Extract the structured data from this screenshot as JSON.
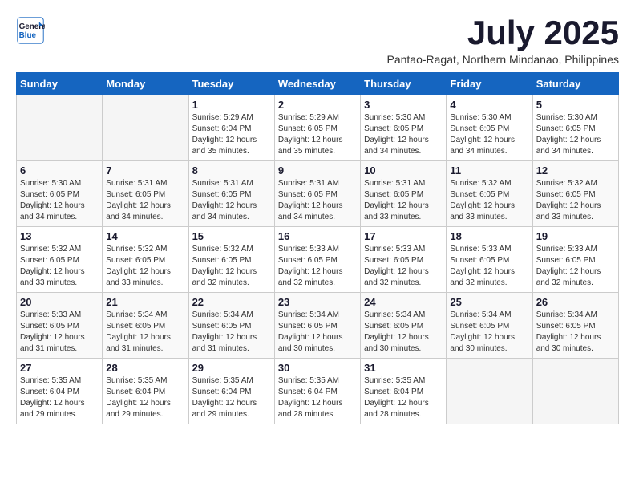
{
  "logo": {
    "line1": "General",
    "line2": "Blue"
  },
  "title": "July 2025",
  "location": "Pantao-Ragat, Northern Mindanao, Philippines",
  "days_header": [
    "Sunday",
    "Monday",
    "Tuesday",
    "Wednesday",
    "Thursday",
    "Friday",
    "Saturday"
  ],
  "weeks": [
    [
      {
        "num": "",
        "sunrise": "",
        "sunset": "",
        "daylight": ""
      },
      {
        "num": "",
        "sunrise": "",
        "sunset": "",
        "daylight": ""
      },
      {
        "num": "1",
        "sunrise": "Sunrise: 5:29 AM",
        "sunset": "Sunset: 6:04 PM",
        "daylight": "Daylight: 12 hours and 35 minutes."
      },
      {
        "num": "2",
        "sunrise": "Sunrise: 5:29 AM",
        "sunset": "Sunset: 6:05 PM",
        "daylight": "Daylight: 12 hours and 35 minutes."
      },
      {
        "num": "3",
        "sunrise": "Sunrise: 5:30 AM",
        "sunset": "Sunset: 6:05 PM",
        "daylight": "Daylight: 12 hours and 34 minutes."
      },
      {
        "num": "4",
        "sunrise": "Sunrise: 5:30 AM",
        "sunset": "Sunset: 6:05 PM",
        "daylight": "Daylight: 12 hours and 34 minutes."
      },
      {
        "num": "5",
        "sunrise": "Sunrise: 5:30 AM",
        "sunset": "Sunset: 6:05 PM",
        "daylight": "Daylight: 12 hours and 34 minutes."
      }
    ],
    [
      {
        "num": "6",
        "sunrise": "Sunrise: 5:30 AM",
        "sunset": "Sunset: 6:05 PM",
        "daylight": "Daylight: 12 hours and 34 minutes."
      },
      {
        "num": "7",
        "sunrise": "Sunrise: 5:31 AM",
        "sunset": "Sunset: 6:05 PM",
        "daylight": "Daylight: 12 hours and 34 minutes."
      },
      {
        "num": "8",
        "sunrise": "Sunrise: 5:31 AM",
        "sunset": "Sunset: 6:05 PM",
        "daylight": "Daylight: 12 hours and 34 minutes."
      },
      {
        "num": "9",
        "sunrise": "Sunrise: 5:31 AM",
        "sunset": "Sunset: 6:05 PM",
        "daylight": "Daylight: 12 hours and 34 minutes."
      },
      {
        "num": "10",
        "sunrise": "Sunrise: 5:31 AM",
        "sunset": "Sunset: 6:05 PM",
        "daylight": "Daylight: 12 hours and 33 minutes."
      },
      {
        "num": "11",
        "sunrise": "Sunrise: 5:32 AM",
        "sunset": "Sunset: 6:05 PM",
        "daylight": "Daylight: 12 hours and 33 minutes."
      },
      {
        "num": "12",
        "sunrise": "Sunrise: 5:32 AM",
        "sunset": "Sunset: 6:05 PM",
        "daylight": "Daylight: 12 hours and 33 minutes."
      }
    ],
    [
      {
        "num": "13",
        "sunrise": "Sunrise: 5:32 AM",
        "sunset": "Sunset: 6:05 PM",
        "daylight": "Daylight: 12 hours and 33 minutes."
      },
      {
        "num": "14",
        "sunrise": "Sunrise: 5:32 AM",
        "sunset": "Sunset: 6:05 PM",
        "daylight": "Daylight: 12 hours and 33 minutes."
      },
      {
        "num": "15",
        "sunrise": "Sunrise: 5:32 AM",
        "sunset": "Sunset: 6:05 PM",
        "daylight": "Daylight: 12 hours and 32 minutes."
      },
      {
        "num": "16",
        "sunrise": "Sunrise: 5:33 AM",
        "sunset": "Sunset: 6:05 PM",
        "daylight": "Daylight: 12 hours and 32 minutes."
      },
      {
        "num": "17",
        "sunrise": "Sunrise: 5:33 AM",
        "sunset": "Sunset: 6:05 PM",
        "daylight": "Daylight: 12 hours and 32 minutes."
      },
      {
        "num": "18",
        "sunrise": "Sunrise: 5:33 AM",
        "sunset": "Sunset: 6:05 PM",
        "daylight": "Daylight: 12 hours and 32 minutes."
      },
      {
        "num": "19",
        "sunrise": "Sunrise: 5:33 AM",
        "sunset": "Sunset: 6:05 PM",
        "daylight": "Daylight: 12 hours and 32 minutes."
      }
    ],
    [
      {
        "num": "20",
        "sunrise": "Sunrise: 5:33 AM",
        "sunset": "Sunset: 6:05 PM",
        "daylight": "Daylight: 12 hours and 31 minutes."
      },
      {
        "num": "21",
        "sunrise": "Sunrise: 5:34 AM",
        "sunset": "Sunset: 6:05 PM",
        "daylight": "Daylight: 12 hours and 31 minutes."
      },
      {
        "num": "22",
        "sunrise": "Sunrise: 5:34 AM",
        "sunset": "Sunset: 6:05 PM",
        "daylight": "Daylight: 12 hours and 31 minutes."
      },
      {
        "num": "23",
        "sunrise": "Sunrise: 5:34 AM",
        "sunset": "Sunset: 6:05 PM",
        "daylight": "Daylight: 12 hours and 30 minutes."
      },
      {
        "num": "24",
        "sunrise": "Sunrise: 5:34 AM",
        "sunset": "Sunset: 6:05 PM",
        "daylight": "Daylight: 12 hours and 30 minutes."
      },
      {
        "num": "25",
        "sunrise": "Sunrise: 5:34 AM",
        "sunset": "Sunset: 6:05 PM",
        "daylight": "Daylight: 12 hours and 30 minutes."
      },
      {
        "num": "26",
        "sunrise": "Sunrise: 5:34 AM",
        "sunset": "Sunset: 6:05 PM",
        "daylight": "Daylight: 12 hours and 30 minutes."
      }
    ],
    [
      {
        "num": "27",
        "sunrise": "Sunrise: 5:35 AM",
        "sunset": "Sunset: 6:04 PM",
        "daylight": "Daylight: 12 hours and 29 minutes."
      },
      {
        "num": "28",
        "sunrise": "Sunrise: 5:35 AM",
        "sunset": "Sunset: 6:04 PM",
        "daylight": "Daylight: 12 hours and 29 minutes."
      },
      {
        "num": "29",
        "sunrise": "Sunrise: 5:35 AM",
        "sunset": "Sunset: 6:04 PM",
        "daylight": "Daylight: 12 hours and 29 minutes."
      },
      {
        "num": "30",
        "sunrise": "Sunrise: 5:35 AM",
        "sunset": "Sunset: 6:04 PM",
        "daylight": "Daylight: 12 hours and 28 minutes."
      },
      {
        "num": "31",
        "sunrise": "Sunrise: 5:35 AM",
        "sunset": "Sunset: 6:04 PM",
        "daylight": "Daylight: 12 hours and 28 minutes."
      },
      {
        "num": "",
        "sunrise": "",
        "sunset": "",
        "daylight": ""
      },
      {
        "num": "",
        "sunrise": "",
        "sunset": "",
        "daylight": ""
      }
    ]
  ]
}
